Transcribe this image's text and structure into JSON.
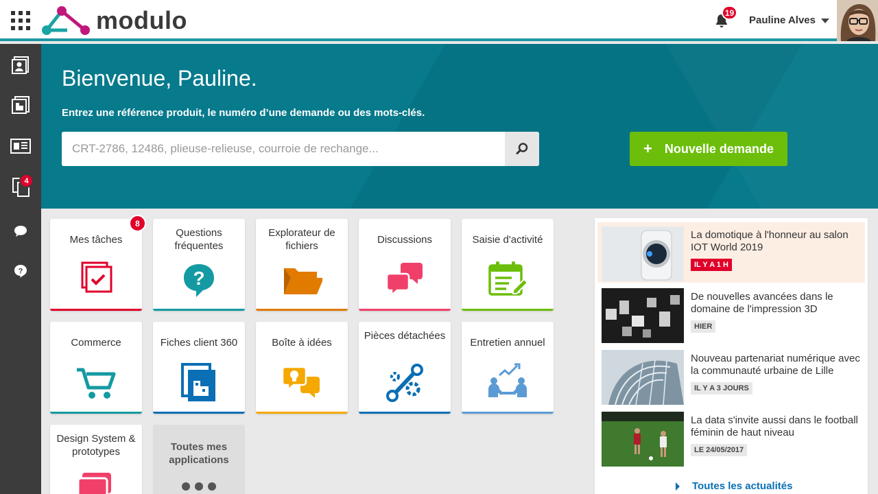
{
  "app": {
    "logo_text": "modulo"
  },
  "header": {
    "notifications_count": "19",
    "user_name": "Pauline Alves"
  },
  "sidebar": {
    "items": [
      {
        "icon": "contact-card-icon"
      },
      {
        "icon": "building-document-icon"
      },
      {
        "icon": "newspaper-icon"
      },
      {
        "icon": "documents-copy-icon"
      },
      {
        "icon": "chat-bubble-icon",
        "badge": "4"
      },
      {
        "icon": "help-bubble-icon"
      }
    ]
  },
  "hero": {
    "title": "Bienvenue, Pauline.",
    "subtitle": "Entrez une référence produit, le numéro d’une demande ou des mots-clés.",
    "search_placeholder": "CRT-2786, 12486, plieuse-relieuse, courroie de rechange...",
    "search_value": "",
    "new_request_plus": "+",
    "new_request_label": "Nouvelle demande"
  },
  "apps": [
    {
      "label": "Mes tâches",
      "badge": "8",
      "icon": "task-check-icon",
      "color": "#e0002a"
    },
    {
      "label": "Questions fréquentes",
      "icon": "faq-question-icon",
      "color": "#149aa2"
    },
    {
      "label": "Explorateur de fichiers",
      "icon": "folder-open-icon",
      "color": "#e07b00"
    },
    {
      "label": "Discussions",
      "icon": "discussion-bubbles-icon",
      "color": "#f0406a"
    },
    {
      "label": "Saisie d'activité",
      "icon": "calendar-edit-icon",
      "color": "#6cbe0a"
    },
    {
      "label": "Commerce",
      "icon": "shopping-cart-icon",
      "color": "#149aa2"
    },
    {
      "label": "Fiches client 360",
      "icon": "client-building-icon",
      "color": "#0a6fb5"
    },
    {
      "label": "Boîte à idées",
      "icon": "idea-bubbles-icon",
      "color": "#f5a800"
    },
    {
      "label": "Pièces détachées",
      "icon": "spare-parts-icon",
      "color": "#0a6fb5"
    },
    {
      "label": "Entretien annuel",
      "icon": "annual-review-icon",
      "color": "#5b9bd5"
    },
    {
      "label": "Design System & prototypes",
      "icon": "design-layers-icon",
      "color": "#f0406a"
    }
  ],
  "all_apps_label": "Toutes mes applications",
  "news": {
    "items": [
      {
        "title": "La domotique à l'honneur au salon IOT World 2019",
        "tag": "IL Y A 1 H",
        "highlight": true,
        "thumb": "smart-thermostat-icon"
      },
      {
        "title": "De nouvelles avancées dans le domaine de l'impression 3D",
        "tag": "HIER",
        "highlight": false,
        "thumb": "3d-printing-blocks-icon"
      },
      {
        "title": "Nouveau partenariat numérique avec la communauté urbaine de Lille",
        "tag": "IL Y A 3 JOURS",
        "highlight": false,
        "thumb": "glass-building-icon"
      },
      {
        "title": "La data s'invite aussi dans le football féminin de haut niveau",
        "tag": "LE 24/05/2017",
        "highlight": false,
        "thumb": "football-players-icon"
      }
    ],
    "more_label": "Toutes les actualités"
  }
}
